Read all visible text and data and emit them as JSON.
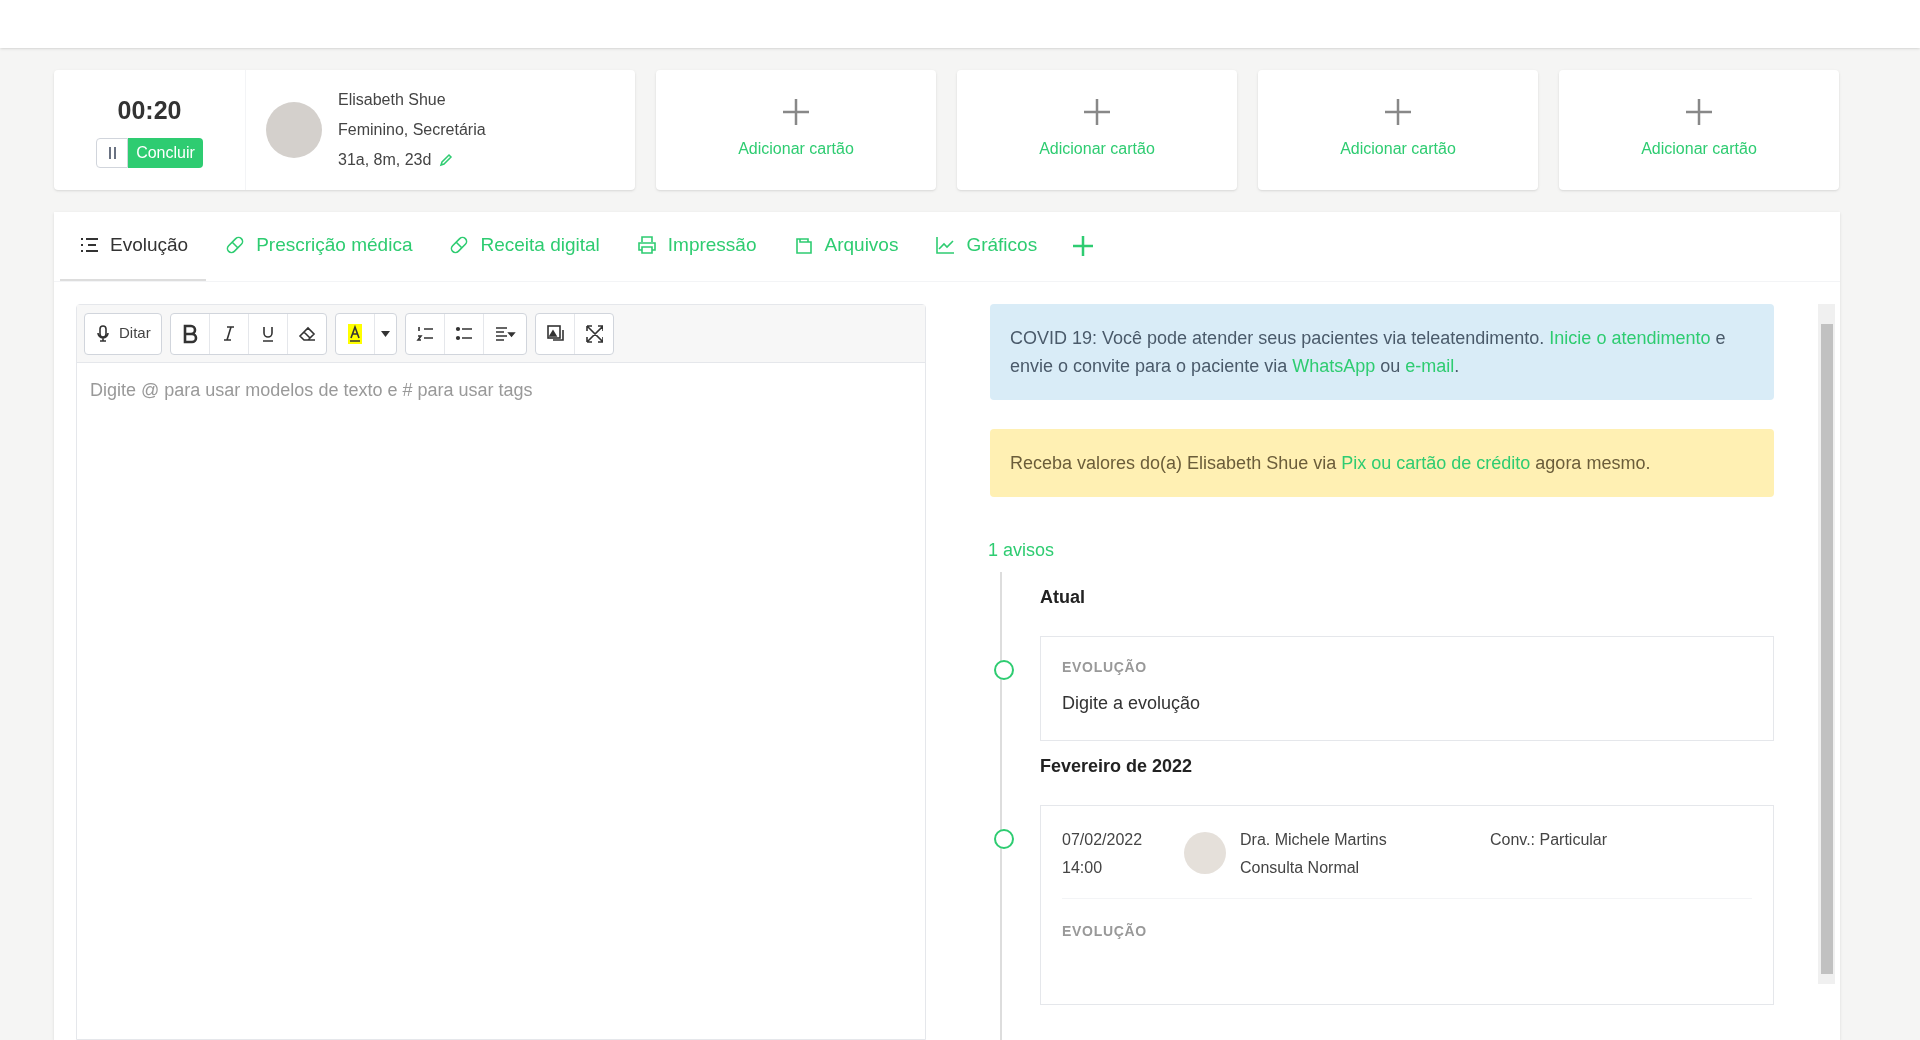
{
  "timer": {
    "time": "00:20",
    "button": "Concluir"
  },
  "patient": {
    "name": "Elisabeth Shue",
    "details": "Feminino, Secretária",
    "age": "31a, 8m, 23d"
  },
  "add_cards": [
    "Adicionar cartão",
    "Adicionar cartão",
    "Adicionar cartão",
    "Adicionar cartão"
  ],
  "tabs": [
    {
      "kind": "list",
      "label": "Evolução",
      "selected": true
    },
    {
      "kind": "pill",
      "label": "Prescrição médica",
      "selected": false
    },
    {
      "kind": "pill",
      "label": "Receita digital",
      "selected": false
    },
    {
      "kind": "printer",
      "label": "Impressão",
      "selected": false
    },
    {
      "kind": "folder",
      "label": "Arquivos",
      "selected": false
    },
    {
      "kind": "chart",
      "label": "Gráficos",
      "selected": false
    }
  ],
  "toolbar": [
    [
      {
        "kind": "mic",
        "label": "Ditar"
      }
    ],
    [
      {
        "kind": "bold"
      },
      {
        "kind": "italic"
      },
      {
        "kind": "underline"
      },
      {
        "kind": "eraser"
      }
    ],
    [
      {
        "kind": "highlight"
      },
      {
        "kind": "caret"
      }
    ],
    [
      {
        "kind": "ol"
      },
      {
        "kind": "ul"
      },
      {
        "kind": "align"
      }
    ],
    [
      {
        "kind": "image"
      },
      {
        "kind": "expand"
      }
    ]
  ],
  "editor": {
    "placeholder": "Digite @ para usar modelos de texto e # para usar tags"
  },
  "notices": [
    {
      "kind": "info",
      "parts": [
        {
          "text": "COVID 19: Você pode atender seus pacientes via teleatendimento.",
          "link": false
        },
        {
          "text": "Inicie o atendimento",
          "link": true
        },
        {
          "text": "e envie o convite para o paciente via",
          "link": false
        },
        {
          "text": "WhatsApp",
          "link": true
        },
        {
          "text": "ou",
          "link": false
        },
        {
          "text": "e-mail",
          "link": true
        },
        {
          "text": ".",
          "link": false
        }
      ]
    },
    {
      "kind": "warning",
      "parts": [
        {
          "text": "Receba valores do(a) Elisabeth Shue via",
          "link": false
        },
        {
          "text": "Pix ou cartão de crédito",
          "link": true
        },
        {
          "text": "agora mesmo.",
          "link": false
        }
      ]
    }
  ],
  "alerts_link": "1 avisos",
  "timeline": [
    {
      "heading": "Atual",
      "entry": {
        "kind": "current",
        "section": "EVOLUÇÃO",
        "text": "Digite a evolução"
      }
    },
    {
      "heading": "Fevereiro de 2022",
      "entry": {
        "kind": "past",
        "date": "07/02/2022",
        "time": "14:00",
        "doctor": "Dra. Michele Martins",
        "type": "Consulta Normal",
        "insurance": "Conv.: Particular",
        "section": "EVOLUÇÃO"
      }
    }
  ]
}
